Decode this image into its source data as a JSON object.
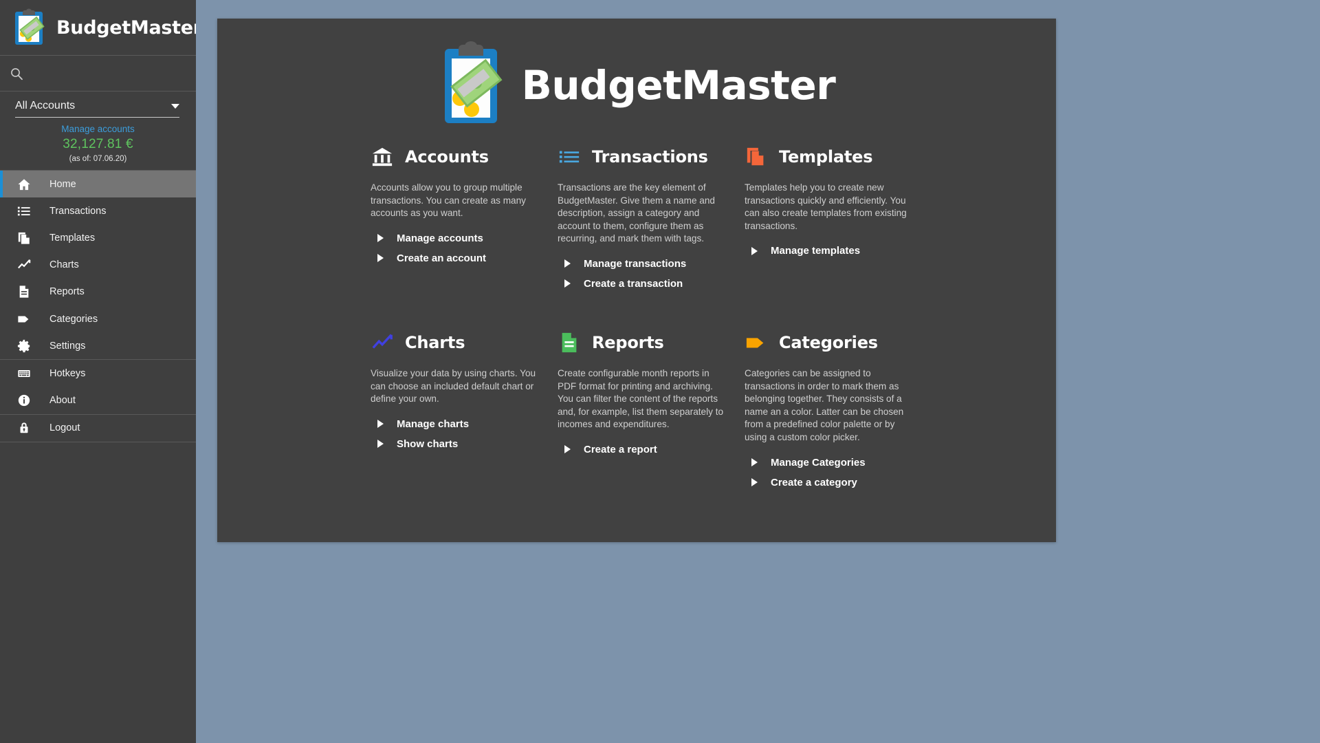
{
  "app": {
    "brand_name": "BudgetMaster",
    "hero_title": "BudgetMaster"
  },
  "sidebar": {
    "search": {
      "value": "",
      "placeholder": ""
    },
    "account": {
      "selected": "All Accounts",
      "manage_link": "Manage accounts",
      "balance": "32,127.81 €",
      "balance_date": "(as of: 07.06.20)"
    },
    "nav_primary": [
      {
        "label": "Home",
        "icon": "home-icon",
        "active": true
      },
      {
        "label": "Transactions",
        "icon": "list-icon",
        "active": false
      },
      {
        "label": "Templates",
        "icon": "copy-icon",
        "active": false
      },
      {
        "label": "Charts",
        "icon": "line-chart-icon",
        "active": false
      },
      {
        "label": "Reports",
        "icon": "document-icon",
        "active": false
      },
      {
        "label": "Categories",
        "icon": "tag-icon",
        "active": false
      },
      {
        "label": "Settings",
        "icon": "gear-icon",
        "active": false
      }
    ],
    "nav_secondary": [
      {
        "label": "Hotkeys",
        "icon": "keyboard-icon",
        "active": false
      },
      {
        "label": "About",
        "icon": "info-icon",
        "active": false
      }
    ],
    "nav_tertiary": [
      {
        "label": "Logout",
        "icon": "lock-icon",
        "active": false
      }
    ]
  },
  "features": [
    {
      "key": "accounts",
      "title": "Accounts",
      "icon": "bank-icon",
      "color": "#ffffff",
      "description": "Accounts allow you to group multiple transactions. You can create as many accounts as you want.",
      "links": [
        "Manage accounts",
        "Create an account"
      ]
    },
    {
      "key": "transactions",
      "title": "Transactions",
      "icon": "list-icon",
      "color": "#4aa8e0",
      "description": "Transactions are the key element of BudgetMaster. Give them a name and description, assign a category and account to them, configure them as recurring, and mark them with tags.",
      "links": [
        "Manage transactions",
        "Create a transaction"
      ]
    },
    {
      "key": "templates",
      "title": "Templates",
      "icon": "copy-icon",
      "color": "#f4663a",
      "description": "Templates help you to create new transactions quickly and efficiently. You can also create templates from existing transactions.",
      "links": [
        "Manage templates"
      ]
    },
    {
      "key": "charts",
      "title": "Charts",
      "icon": "line-chart-icon",
      "color": "#4040e0",
      "description": "Visualize your data by using charts. You can choose an included default chart or define your own.",
      "links": [
        "Manage charts",
        "Show charts"
      ]
    },
    {
      "key": "reports",
      "title": "Reports",
      "icon": "document-icon",
      "color": "#4bbd5c",
      "description": "Create configurable month reports in PDF format for printing and archiving. You can filter the content of the reports and, for example, list them separately to incomes and expenditures.",
      "links": [
        "Create a report"
      ]
    },
    {
      "key": "categories",
      "title": "Categories",
      "icon": "tag-icon",
      "color": "#f9a300",
      "description": "Categories can be assigned to transactions in order to mark them as belonging together. They consists of a name an a color. Latter can be chosen from a predefined color palette or by using a custom color picker.",
      "links": [
        "Manage Categories",
        "Create a category"
      ]
    }
  ],
  "colors": {
    "sidebar_bg": "#3f3f3f",
    "card_bg": "#414141",
    "page_bg": "#7d93ab",
    "accent_blue": "#1b8fd6",
    "link_blue": "#3c9ddb",
    "balance_green": "#5fc45f"
  }
}
